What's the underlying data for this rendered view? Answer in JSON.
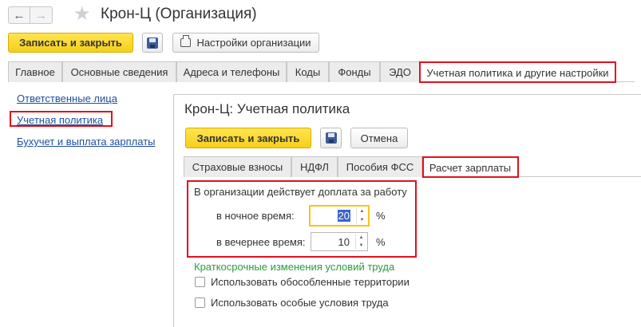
{
  "window": {
    "title": "Крон-Ц (Организация)",
    "nav_back_icon": "←",
    "nav_forward_icon": "→",
    "favorite_icon": "★"
  },
  "toolbar": {
    "save_close_label": "Записать и закрыть",
    "org_settings_label": "Настройки организации"
  },
  "tabs": [
    {
      "label": "Главное"
    },
    {
      "label": "Основные сведения"
    },
    {
      "label": "Адреса и телефоны"
    },
    {
      "label": "Коды"
    },
    {
      "label": "Фонды"
    },
    {
      "label": "ЭДО"
    },
    {
      "label": "Учетная политика и другие настройки"
    }
  ],
  "sidebar": {
    "items": [
      {
        "label": "Ответственные лица"
      },
      {
        "label": "Учетная политика"
      },
      {
        "label": "Бухучет и выплата зарплаты"
      }
    ]
  },
  "policy": {
    "title": "Крон-Ц: Учетная политика",
    "save_close_label": "Записать и закрыть",
    "cancel_label": "Отмена",
    "tabs": [
      {
        "label": "Страховые взносы"
      },
      {
        "label": "НДФЛ"
      },
      {
        "label": "Пособия ФСС"
      },
      {
        "label": "Расчет зарплаты"
      }
    ],
    "surcharge": {
      "heading": "В организации действует доплата за работу",
      "night_label": "в ночное время:",
      "night_value": "20",
      "evening_label": "в вечернее время:",
      "evening_value": "10",
      "percent": "%"
    },
    "short_term": {
      "heading": "Краткосрочные изменения условий труда",
      "separate_territories": "Использовать обособленные территории",
      "special_conditions": "Использовать особые условия труда"
    }
  },
  "colors": {
    "accent_yellow": "#f6cf1b",
    "highlight_red": "#e3101c",
    "link_blue": "#1f4f9c",
    "green_heading": "#2a9a3e"
  }
}
